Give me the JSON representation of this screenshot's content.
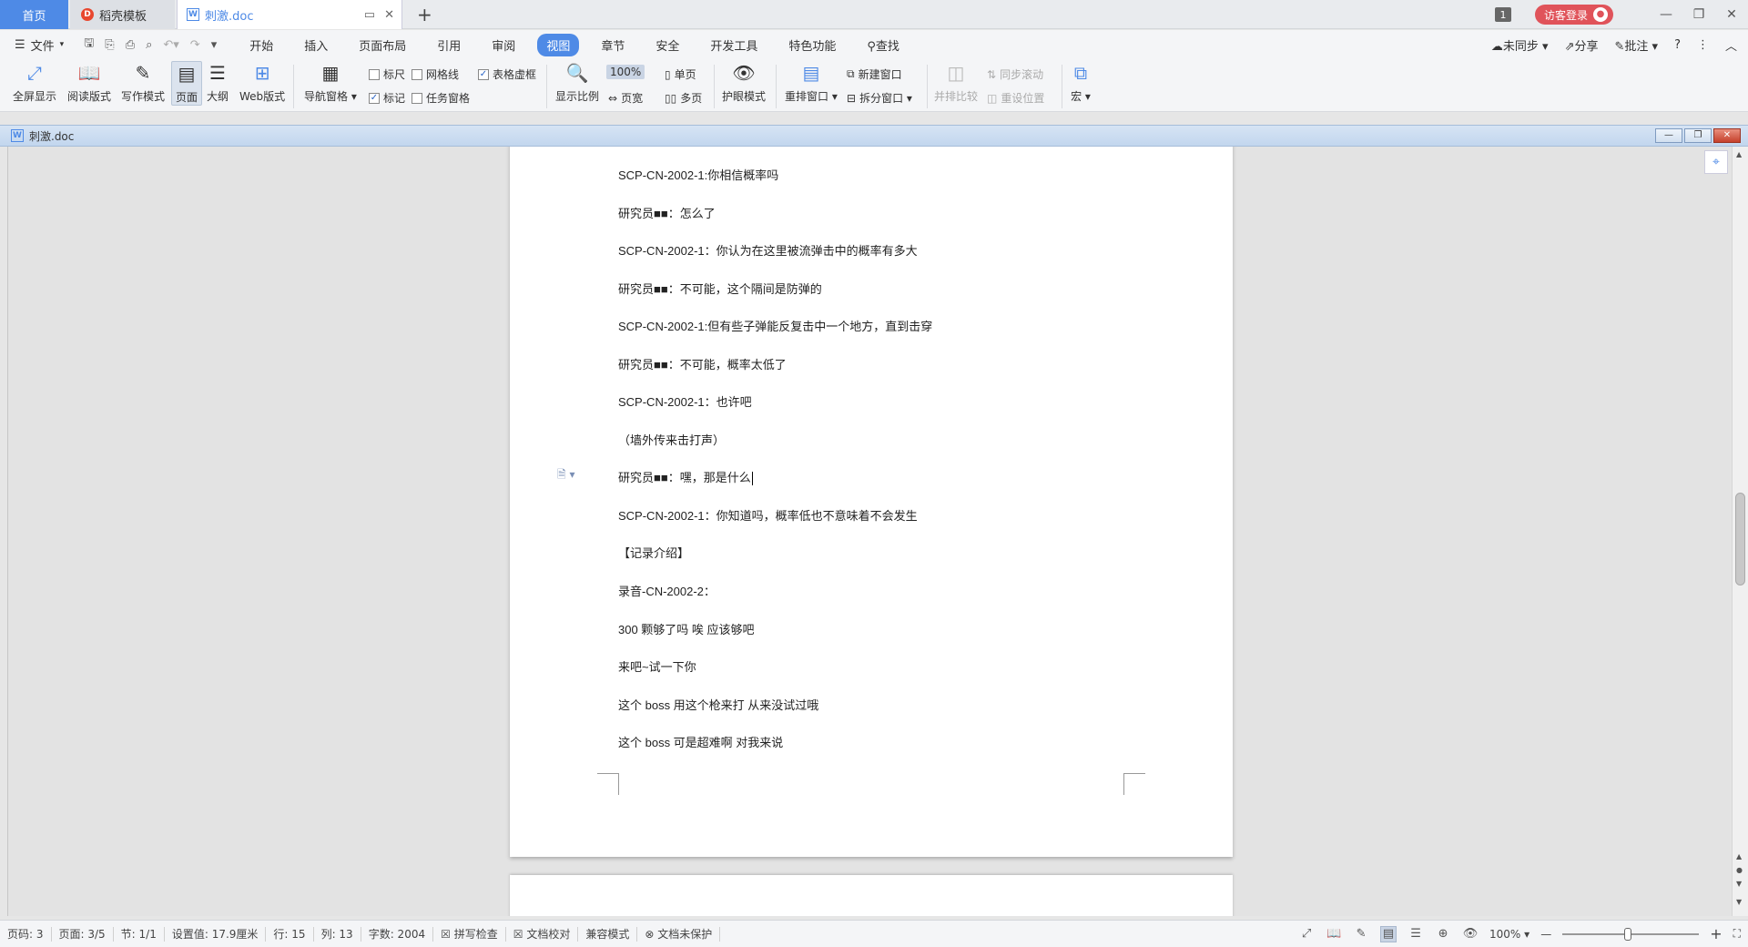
{
  "tabs": {
    "home": "首页",
    "template": "稻壳模板",
    "doc": "刺激.doc",
    "badge": "1",
    "login": "访客登录"
  },
  "menu": {
    "file": "文件",
    "items": [
      "开始",
      "插入",
      "页面布局",
      "引用",
      "审阅",
      "视图",
      "章节",
      "安全",
      "开发工具",
      "特色功能"
    ],
    "active_index": 5,
    "search": "查找",
    "sync": "未同步",
    "share": "分享",
    "annotate": "批注"
  },
  "ribbon": {
    "fullscreen": "全屏显示",
    "reading": "阅读版式",
    "writing": "写作模式",
    "page": "页面",
    "outline": "大纲",
    "web": "Web版式",
    "nav_pane": "导航窗格",
    "ruler": "标尺",
    "gridlines": "网格线",
    "table_grid": "表格虚框",
    "markup": "标记",
    "task_pane": "任务窗格",
    "zoom": "显示比例",
    "zoom100": "100%",
    "single_page": "单页",
    "page_width": "页宽",
    "multi_page": "多页",
    "eye_mode": "护眼模式",
    "arrange": "重排窗口",
    "new_window": "新建窗口",
    "split_window": "拆分窗口",
    "side_by_side": "并排比较",
    "sync_scroll": "同步滚动",
    "reset_position": "重设位置",
    "macro": "宏"
  },
  "docwindow": {
    "title": "刺激.doc"
  },
  "document": {
    "lines": [
      "SCP-CN-2002-1:你相信概率吗",
      "研究员■■：怎么了",
      "SCP-CN-2002-1：你认为在这里被流弹击中的概率有多大",
      "研究员■■：不可能，这个隔间是防弹的",
      "SCP-CN-2002-1:但有些子弹能反复击中一个地方，直到击穿",
      "研究员■■：不可能，概率太低了",
      "SCP-CN-2002-1：也许吧",
      "（墙外传来击打声）",
      "研究员■■：嘿，那是什么",
      "SCP-CN-2002-1：你知道吗，概率低也不意味着不会发生",
      "【记录介绍】",
      "录音-CN-2002-2：",
      "300 颗够了吗  唉  应该够吧",
      "来吧~试一下你",
      "这个 boss  用这个枪来打  从来没试过哦",
      "这个 boss 可是超难啊  对我来说"
    ]
  },
  "status": {
    "page_num": "页码: 3",
    "pages": "页面: 3/5",
    "section": "节: 1/1",
    "setting": "设置值: 17.9厘米",
    "row": "行: 15",
    "col": "列: 13",
    "words": "字数: 2004",
    "spell": "拼写检查",
    "proof": "文档校对",
    "compat": "兼容模式",
    "protect": "文档未保护",
    "zoom": "100%"
  }
}
